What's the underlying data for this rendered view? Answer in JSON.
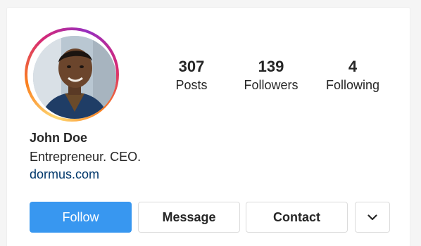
{
  "profile": {
    "name": "John Doe",
    "bio": "Entrepreneur. CEO.",
    "link": "dormus.com"
  },
  "stats": [
    {
      "value": "307",
      "label": "Posts"
    },
    {
      "value": "139",
      "label": "Followers"
    },
    {
      "value": "4",
      "label": "Following"
    }
  ],
  "actions": {
    "follow": "Follow",
    "message": "Message",
    "contact": "Contact",
    "more_icon": "chevron-down-icon"
  },
  "colors": {
    "follow_blue": "#3897f0",
    "link_blue": "#00376b",
    "ring_gradient": [
      "#feda75",
      "#fa7e1e",
      "#d62976",
      "#962fbf"
    ]
  }
}
